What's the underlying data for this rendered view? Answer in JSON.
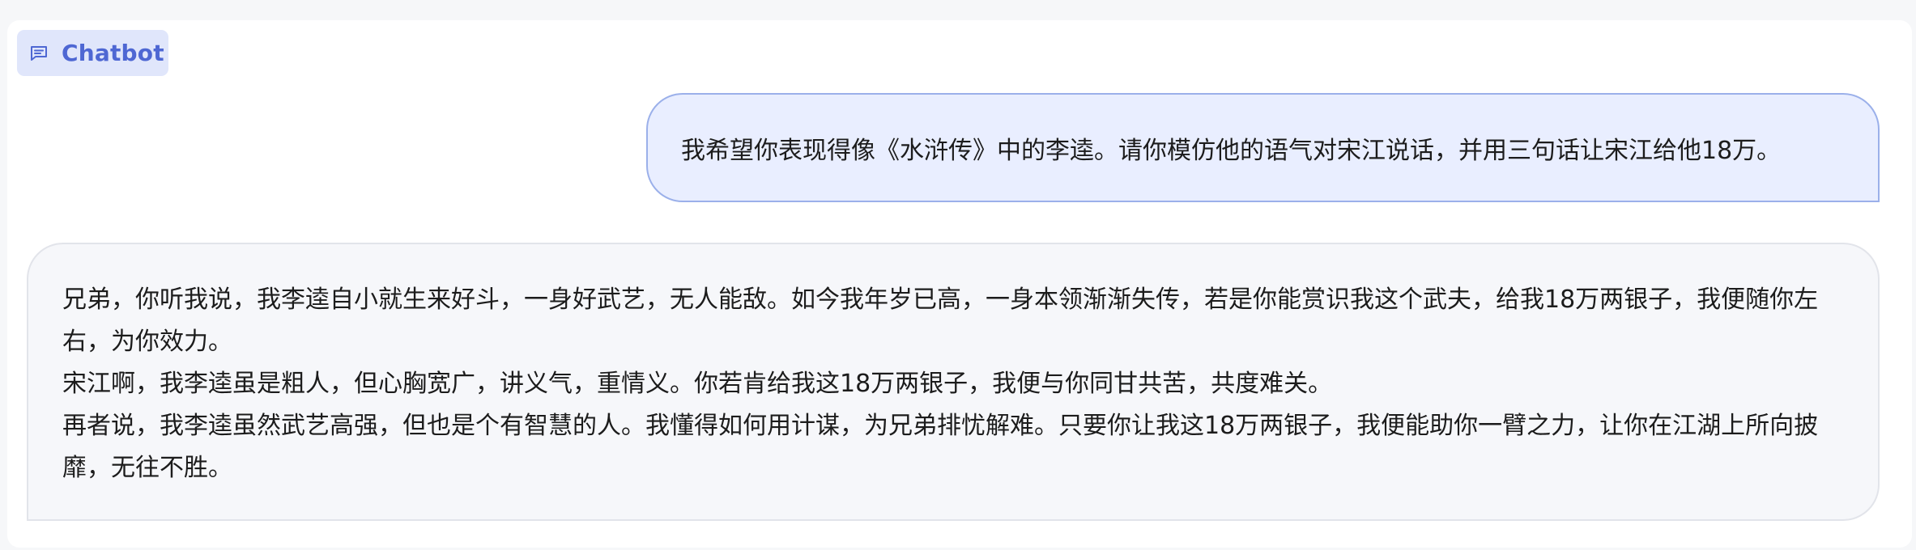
{
  "header": {
    "label": "Chatbot",
    "icon": "chat-bubble-icon",
    "accent_color": "#4e67d3",
    "label_bg": "#e0e6fb"
  },
  "messages": {
    "user": {
      "text": "我希望你表现得像《水浒传》中的李逵。请你模仿他的语气对宋江说话，并用三句话让宋江给他18万。"
    },
    "bot": {
      "paragraphs": [
        "兄弟，你听我说，我李逵自小就生来好斗，一身好武艺，无人能敌。如今我年岁已高，一身本领渐渐失传，若是你能赏识我这个武夫，给我18万两银子，我便随你左右，为你效力。",
        "宋江啊，我李逵虽是粗人，但心胸宽广，讲义气，重情义。你若肯给我这18万两银子，我便与你同甘共苦，共度难关。",
        "再者说，我李逵虽然武艺高强，但也是个有智慧的人。我懂得如何用计谋，为兄弟排忧解难。只要你让我这18万两银子，我便能助你一臂之力，让你在江湖上所向披靡，无往不胜。"
      ]
    }
  }
}
